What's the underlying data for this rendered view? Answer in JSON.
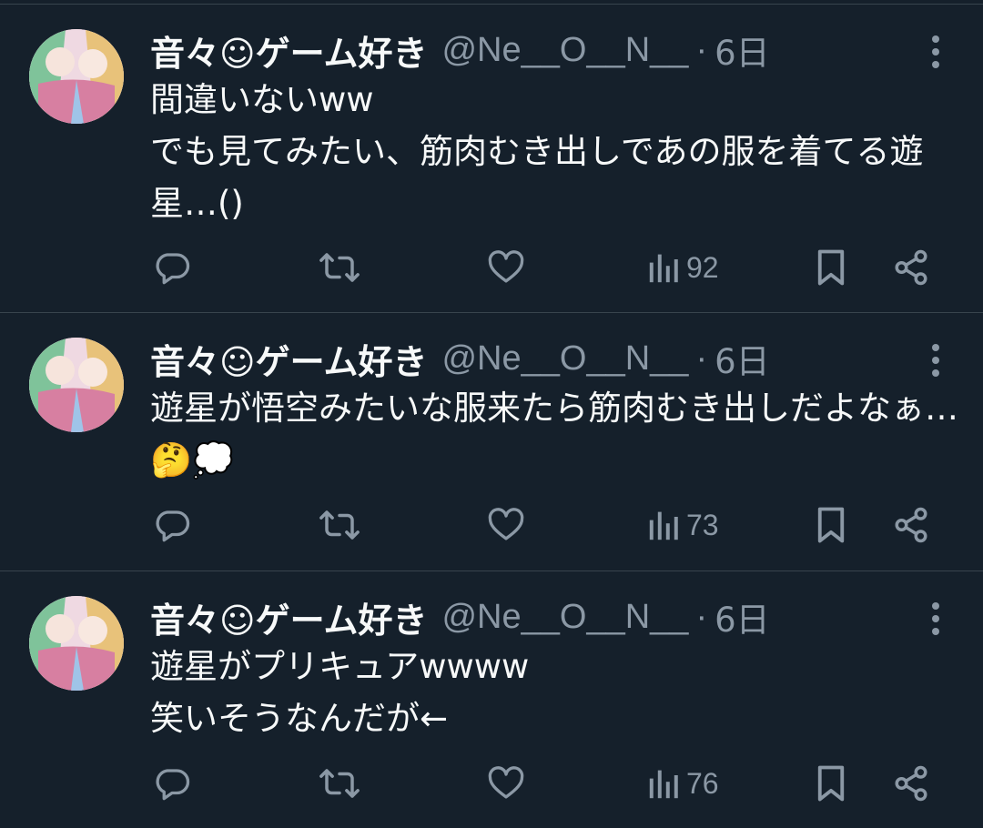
{
  "tweets": [
    {
      "author_name": "音々☺ゲーム好き",
      "author_handle": "@Ne__O__N__",
      "time": "6日",
      "text": "間違いないww\nでも見てみたい、筋肉むき出しであの服を着てる遊星…()",
      "views": "92"
    },
    {
      "author_name": "音々☺ゲーム好き",
      "author_handle": "@Ne__O__N__",
      "time": "6日",
      "text": "遊星が悟空みたいな服来たら筋肉むき出しだよなぁ…🤔💭",
      "views": "73"
    },
    {
      "author_name": "音々☺ゲーム好き",
      "author_handle": "@Ne__O__N__",
      "time": "6日",
      "text": "遊星がプリキュアwwww\n笑いそうなんだが←",
      "views": "76"
    }
  ],
  "separator_dot": "·",
  "icons": {
    "reply": "reply-icon",
    "retweet": "retweet-icon",
    "like": "heart-icon",
    "views": "views-chart-icon",
    "bookmark": "bookmark-icon",
    "share": "share-icon",
    "more": "more-vertical-icon"
  },
  "colors": {
    "background": "#15202b",
    "text_primary": "#f7f9f9",
    "text_secondary": "#8b98a5",
    "divider": "#38444d"
  }
}
